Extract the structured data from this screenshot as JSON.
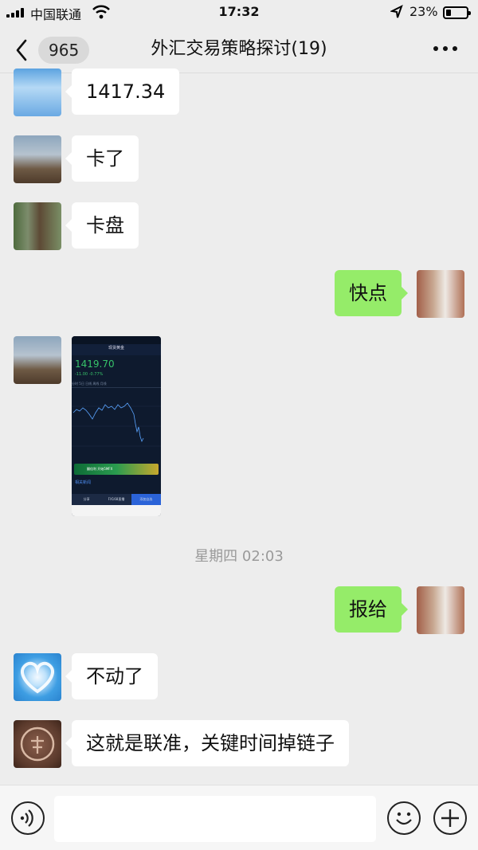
{
  "status_bar": {
    "carrier": "中国联通",
    "time": "17:32",
    "battery": "23%",
    "battery_level": 0.23,
    "icons": [
      "signal-icon",
      "wifi-icon",
      "location-arrow-icon",
      "battery-icon"
    ]
  },
  "nav": {
    "back_count": "965",
    "title": "外汇交易策略探讨(19)",
    "icons": [
      "back-chevron-icon",
      "more-dots-icon"
    ]
  },
  "messages": [
    {
      "side": "left",
      "avatar": "sky-clouds-avatar",
      "text": "1417.34"
    },
    {
      "side": "left",
      "avatar": "airplane-avatar",
      "text": "卡了"
    },
    {
      "side": "left",
      "avatar": "forest-person-avatar",
      "text": "卡盘"
    },
    {
      "side": "right",
      "avatar": "man-avatar",
      "text": "快点"
    },
    {
      "side": "left",
      "avatar": "airplane-avatar",
      "type": "image"
    },
    {
      "side": "right",
      "avatar": "man-avatar",
      "text": "报给"
    },
    {
      "side": "left",
      "avatar": "cloud-heart-avatar",
      "text": "不动了"
    },
    {
      "side": "left",
      "avatar": "stamp-seal-avatar",
      "text": "这就是联准，关键时间掉链子"
    }
  ],
  "timestamp": "星期四 02:03",
  "screenshot": {
    "header": "现货黄金",
    "price": "1419.70",
    "change": "-11.00   -0.77%",
    "tabs": [
      "分时",
      "5日",
      "日线",
      "周线",
      "月线"
    ],
    "banner": "翻倍利 开始5MFX",
    "news_label": "相关新闻",
    "bottom_buttons": [
      "分享",
      "FX168直播",
      "添加自选"
    ]
  },
  "input_bar": {
    "icons": [
      "voice-icon",
      "emoji-icon",
      "plus-icon"
    ]
  },
  "colors": {
    "background": "#ededed",
    "bubble_self": "#95ec69",
    "bubble_other": "#ffffff",
    "timestamp": "#9a9a9a"
  }
}
